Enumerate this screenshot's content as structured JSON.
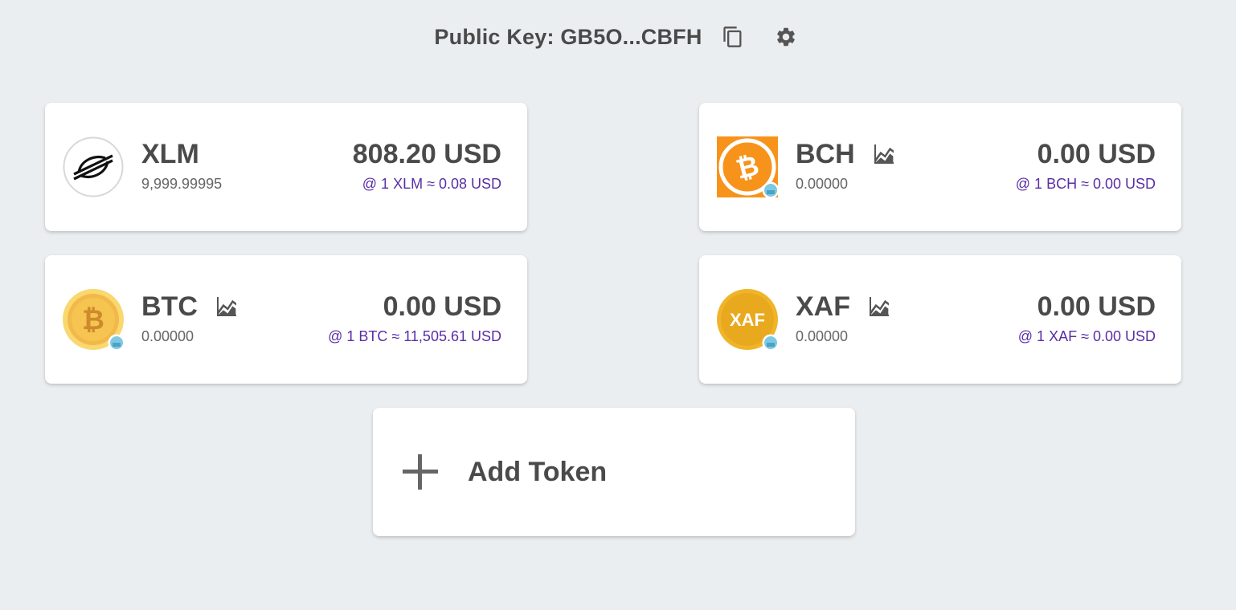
{
  "header": {
    "public_key_label": "Public Key: GB5O...CBFH",
    "copy_icon": "copy-icon",
    "settings_icon": "gear-icon"
  },
  "tokens": [
    {
      "symbol": "XLM",
      "balance": "9,999.99995",
      "usd_value": "808.20 USD",
      "rate": "@ 1 XLM ≈ 0.08 USD",
      "logo": "stellar-logo",
      "has_chart": false
    },
    {
      "symbol": "BCH",
      "balance": "0.00000",
      "usd_value": "0.00 USD",
      "rate": "@ 1 BCH ≈ 0.00 USD",
      "logo": "bitcoin-cash-logo",
      "has_chart": true
    },
    {
      "symbol": "BTC",
      "balance": "0.00000",
      "usd_value": "0.00 USD",
      "rate": "@ 1 BTC ≈ 11,505.61 USD",
      "logo": "bitcoin-logo",
      "has_chart": true
    },
    {
      "symbol": "XAF",
      "balance": "0.00000",
      "usd_value": "0.00 USD",
      "rate": "@ 1 XAF ≈ 0.00 USD",
      "logo": "xaf-logo",
      "has_chart": true
    }
  ],
  "add_token": {
    "label": "Add Token",
    "icon": "plus-icon"
  },
  "colors": {
    "background": "#ebeef0",
    "rate_text": "#5a2ea6",
    "bch_orange": "#f7931a",
    "btc_gold": "#f5c451",
    "xaf_gold": "#f0b429"
  }
}
